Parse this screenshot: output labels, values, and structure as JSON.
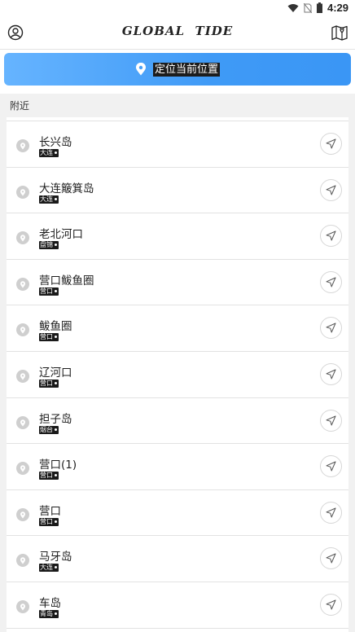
{
  "status_bar": {
    "time": "4:29"
  },
  "app": {
    "title": "GLOBAL  TIDE"
  },
  "locate": {
    "label": "定位当前位置"
  },
  "section": {
    "nearby_label": "附近"
  },
  "places": [
    {
      "name": "长兴岛",
      "region": "大连"
    },
    {
      "name": "大连簸箕岛",
      "region": "大连"
    },
    {
      "name": "老北河口",
      "region": "盘锦"
    },
    {
      "name": "营口鲅鱼圈",
      "region": "营口"
    },
    {
      "name": "鲅鱼圈",
      "region": "营口"
    },
    {
      "name": "辽河口",
      "region": "营口"
    },
    {
      "name": "担子岛",
      "region": "烟台"
    },
    {
      "name": "营口(1)",
      "region": "营口"
    },
    {
      "name": "营口",
      "region": "营口"
    },
    {
      "name": "马牙岛",
      "region": "大连"
    },
    {
      "name": "车岛",
      "region": "青岛"
    }
  ],
  "icons": {
    "user": "user-icon",
    "map": "map-pin-icon",
    "locate": "location-pin-icon",
    "place": "place-pin-icon",
    "navigate": "navigate-arrow-icon"
  },
  "colors": {
    "accent": "#3f9af6",
    "accent_light": "#66b4ff"
  }
}
